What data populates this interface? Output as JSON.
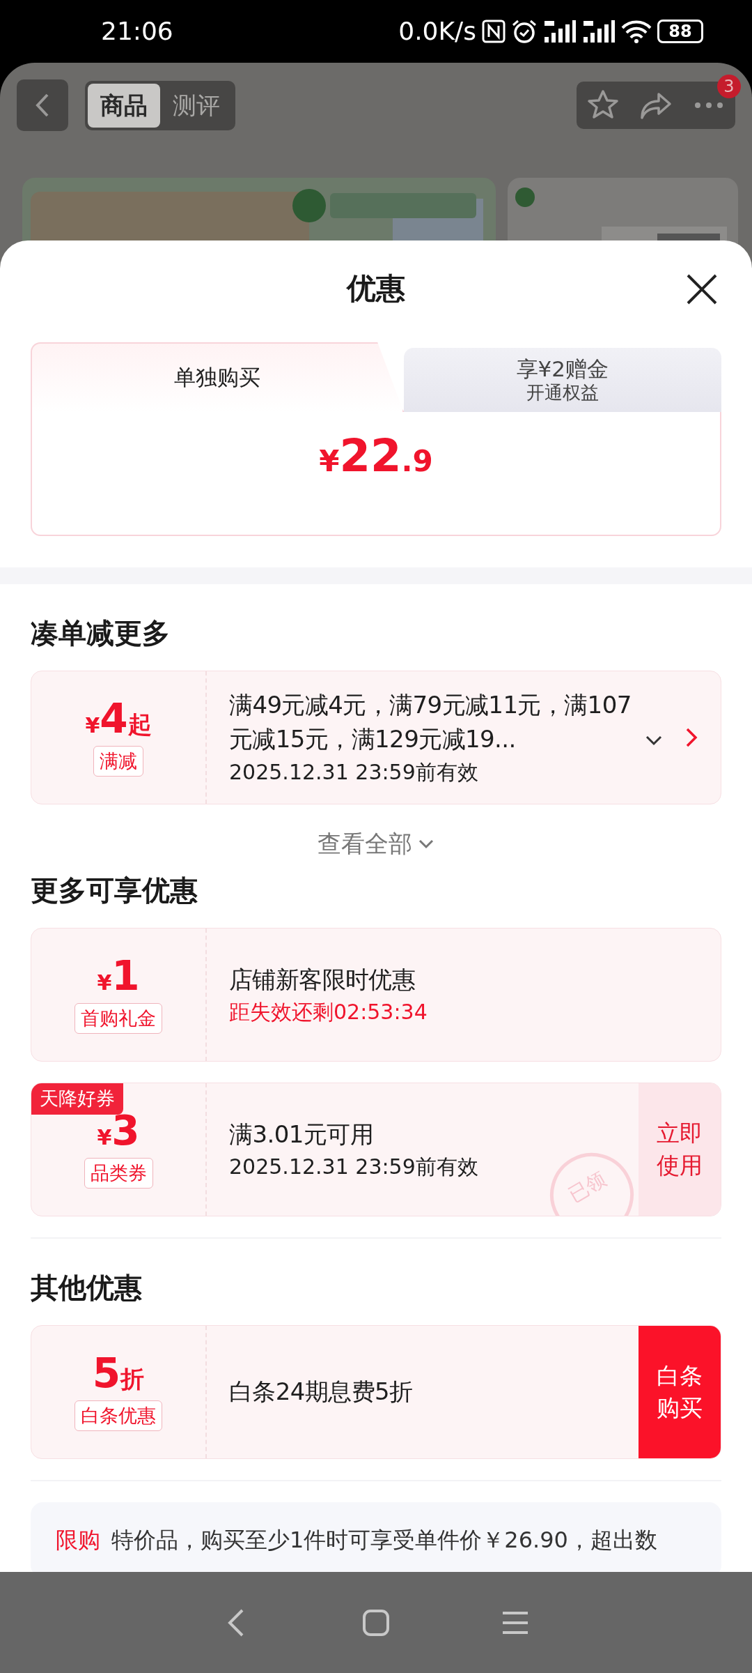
{
  "status_bar": {
    "time": "21:06",
    "net_speed": "0.0K/s",
    "battery": "88"
  },
  "page_header": {
    "tabs": [
      {
        "label": "商品",
        "selected": true
      },
      {
        "label": "测评",
        "selected": false
      }
    ],
    "more_badge": "3"
  },
  "sheet": {
    "title": "优惠",
    "price_tabs": [
      {
        "label": "单独购买",
        "selected": true
      },
      {
        "label": "享¥2赠金",
        "sublabel": "开通权益",
        "selected": false
      }
    ],
    "price": {
      "currency": "¥",
      "integer": "22",
      "decimal": ".9"
    },
    "sections": [
      {
        "title": "凑单减更多",
        "coupons": [
          {
            "amount_prefix": "¥",
            "amount": "4",
            "amount_suffix": "起",
            "tag": "满减",
            "title": "满49元减4元，满79元减11元，满107元减15元，满129元减19...",
            "expandable": true,
            "subtitle": "2025.12.31 23:59前有效",
            "subtitle_highlighted": false,
            "action": {
              "kind": "arrow"
            }
          }
        ],
        "more_link": "查看全部"
      },
      {
        "title": "更多可享优惠",
        "coupons": [
          {
            "amount_prefix": "¥",
            "amount": "1",
            "tag": "首购礼金",
            "title": "店铺新客限时优惠",
            "subtitle": "距失效还剩02:53:34",
            "subtitle_highlighted": true
          },
          {
            "ribbon": "天降好券",
            "amount_prefix": "¥",
            "amount": "3",
            "tag": "品类券",
            "title": "满3.01元可用",
            "subtitle": "2025.12.31 23:59前有效",
            "subtitle_highlighted": false,
            "stamp": "已领",
            "action": {
              "kind": "soft",
              "label": "立即使用"
            }
          }
        ]
      },
      {
        "title": "其他优惠",
        "coupons": [
          {
            "amount": "5",
            "amount_suffix": "折",
            "tag": "白条优惠",
            "title": "白条24期息费5折",
            "action": {
              "kind": "solid",
              "label": "白条购买"
            }
          }
        ]
      }
    ],
    "notice": {
      "tag": "限购",
      "text": "特价品，购买至少1件时可享受单件价￥26.90，超出数"
    }
  }
}
